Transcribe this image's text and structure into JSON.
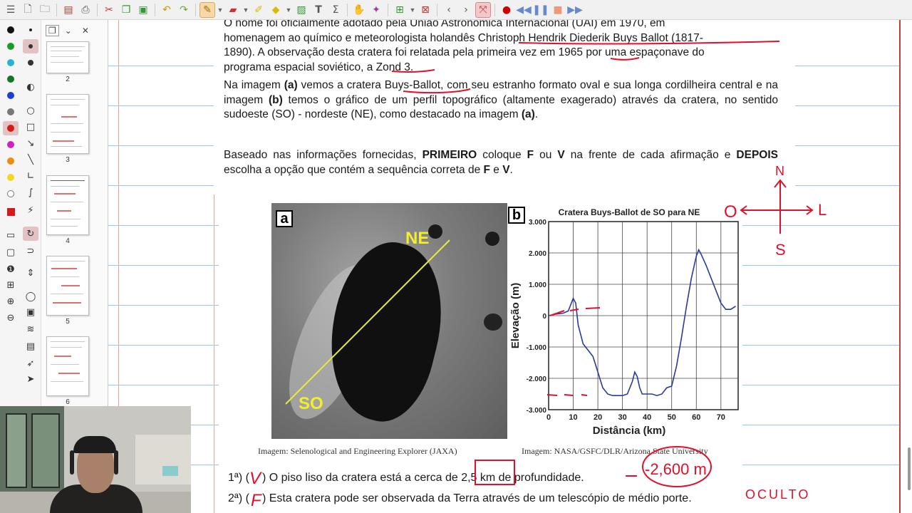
{
  "document": {
    "p1_lines": [
      "O nome foi oficialmente adotado pela União Astronômica Internacional (UAI) em 1970, em",
      "homenagem ao químico e meteorologista holandês Christoph Hendrik Diederik Buys Ballot (1817-",
      "1890). A observação desta cratera foi relatada pela primeira vez em 1965 por uma espaçonave do",
      "programa espacial soviético, a Zond 3."
    ],
    "p2": {
      "t1": "Na imagem ",
      "b1": "(a)",
      "t2": " vemos a cratera Buys-Ballot, com seu estranho formato oval e sua longa cordilheira central e na imagem ",
      "b2": "(b)",
      "t3": " temos o gráfico de um perfil topográfico (altamente exagerado) através da cratera, no sentido sudoeste (SO) - nordeste (NE), como destacado na imagem ",
      "b3": "(a)",
      "t4": "."
    },
    "p3": {
      "t1": "Baseado nas informações fornecidas, ",
      "b1": "PRIMEIRO",
      "t2": " coloque ",
      "b2": "F",
      "t3": " ou ",
      "b3": "V",
      "t4": " na frente de cada afirmação e ",
      "b4": "DEPOIS",
      "t5": " escolha a opção que contém a sequência correta de ",
      "b5": "F",
      "t6": " e ",
      "b6": "V",
      "t7": "."
    },
    "figure_a": {
      "tag": "a",
      "label_ne": "NE",
      "label_so": "SO"
    },
    "figure_b": {
      "tag": "b"
    },
    "caption_a": "Imagem: Selenological and Engineering Explorer (JAXA)",
    "caption_b": "Imagem: NASA/GSFC/DLR/Arizona State University",
    "q1": {
      "num": "1ª)",
      "open": "(",
      "close": ")",
      "text": "O piso liso da cratera está a cerca de 2,5 km de profundidade."
    },
    "q2": {
      "num": "2ª)",
      "open": "(",
      "close": ")",
      "text": "Esta cratera pode ser observada da Terra através de um telescópio de médio porte."
    }
  },
  "annotations": {
    "q1_mark": "V",
    "q2_mark": "F",
    "depth_note": "-2,600 m",
    "oculto_note": "OCULTO",
    "compass": {
      "n": "N",
      "s": "S",
      "o": "O",
      "l": "L"
    }
  },
  "thumbs": [
    "2",
    "3",
    "4",
    "5",
    "6"
  ],
  "colors": {
    "ink_red": "#e0102a",
    "chart_line": "#2b3a9a",
    "margin_red": "#c04040",
    "rule_blue": "#99c7e8",
    "toolbar": "#f1f1f1"
  },
  "icons": [
    "new-page-icon",
    "open-icon",
    "pdf-icon",
    "print-icon",
    "cut-icon",
    "copy-icon",
    "paste-icon",
    "undo-icon",
    "redo-icon",
    "pen-icon",
    "eraser-icon",
    "highlighter-icon",
    "shapes-icon",
    "image-icon",
    "text-icon",
    "formula-icon",
    "hand-icon",
    "pointer-icon",
    "insert-page-icon",
    "delete-page-icon",
    "prev-page-icon",
    "next-page-icon",
    "fit-icon",
    "record-icon",
    "rewind-icon",
    "pause-icon",
    "stop-icon",
    "forward-icon"
  ],
  "chart_data": {
    "type": "line",
    "title": "Cratera Buys-Ballot de SO para NE",
    "xlabel": "Distância (km)",
    "ylabel": "Elevação (m)",
    "xlim": [
      0,
      77
    ],
    "ylim": [
      -3000,
      3000
    ],
    "xticks": [
      "0",
      "10",
      "20",
      "30",
      "40",
      "50",
      "60",
      "70"
    ],
    "yticks": [
      "3.000",
      "2.000",
      "1.000",
      "0",
      "-1.000",
      "-2.000",
      "-3.000"
    ],
    "grid": true,
    "series": [
      {
        "x": [
          0,
          3,
          6,
          8,
          10,
          11,
          12,
          14,
          16,
          18,
          20,
          22,
          24,
          26,
          28,
          30,
          32,
          34,
          35,
          36,
          37,
          38,
          40,
          42,
          44,
          46,
          48,
          50,
          52,
          54,
          56,
          58,
          60,
          61,
          62,
          64,
          66,
          68,
          70,
          72,
          74,
          76
        ],
        "y": [
          0,
          50,
          80,
          150,
          550,
          400,
          -300,
          -900,
          -1100,
          -1300,
          -1800,
          -2300,
          -2500,
          -2550,
          -2550,
          -2550,
          -2500,
          -2100,
          -1800,
          -1950,
          -2300,
          -2500,
          -2500,
          -2500,
          -2550,
          -2500,
          -2300,
          -2250,
          -1600,
          -700,
          300,
          1200,
          1900,
          2100,
          1950,
          1600,
          1200,
          800,
          400,
          200,
          200,
          300
        ]
      }
    ]
  }
}
